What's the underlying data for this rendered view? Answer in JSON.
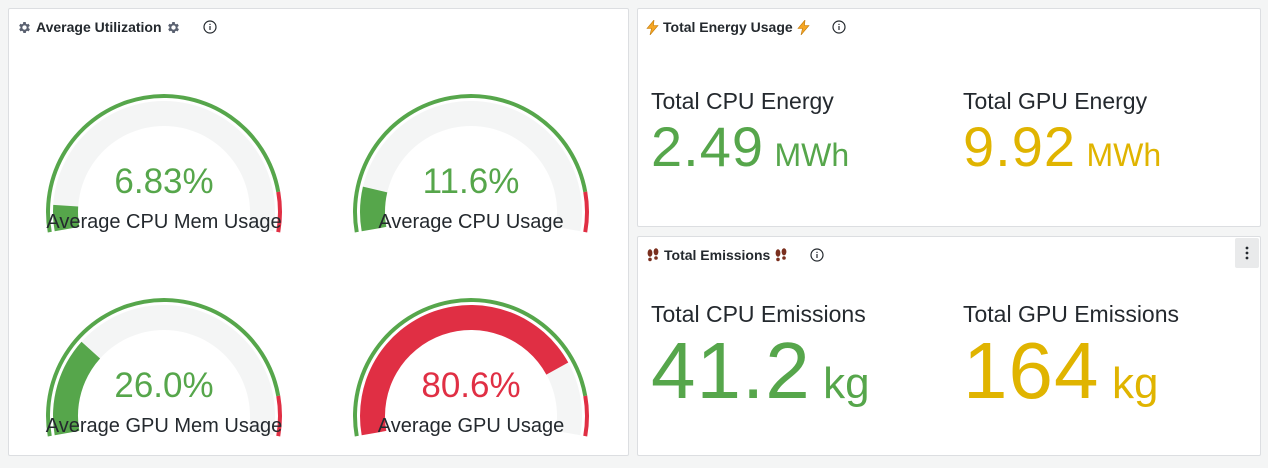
{
  "colors": {
    "green": "#56a64b",
    "yellow": "#e0b400",
    "red": "#e02f44",
    "track": "#f4f5f5"
  },
  "utilization": {
    "title": "Average Utilization",
    "title_icons": [
      "gear-icon",
      "gear-icon"
    ],
    "gauges": [
      {
        "title": "Average CPU Mem Usage",
        "value": 6.83,
        "display": "6.83%",
        "color": "green"
      },
      {
        "title": "Average CPU Usage",
        "value": 11.6,
        "display": "11.6%",
        "color": "green"
      },
      {
        "title": "Average GPU Mem Usage",
        "value": 26.0,
        "display": "26.0%",
        "color": "green"
      },
      {
        "title": "Average GPU Usage",
        "value": 80.6,
        "display": "80.6%",
        "color": "red"
      }
    ],
    "gauge_min": 0,
    "gauge_max": 100,
    "threshold_red_from": 90
  },
  "energy": {
    "title": "Total Energy Usage",
    "title_icons": [
      "lightning-icon",
      "lightning-icon"
    ],
    "stats": [
      {
        "title": "Total CPU Energy",
        "value": "2.49",
        "unit": "MWh",
        "color": "green"
      },
      {
        "title": "Total GPU Energy",
        "value": "9.92",
        "unit": "MWh",
        "color": "yellow"
      }
    ]
  },
  "emissions": {
    "title": "Total Emissions",
    "title_icons": [
      "footprints-icon",
      "footprints-icon"
    ],
    "stats": [
      {
        "title": "Total CPU Emissions",
        "value": "41.2",
        "unit": "kg",
        "color": "green"
      },
      {
        "title": "Total GPU Emissions",
        "value": "164",
        "unit": "kg",
        "color": "yellow"
      }
    ]
  }
}
